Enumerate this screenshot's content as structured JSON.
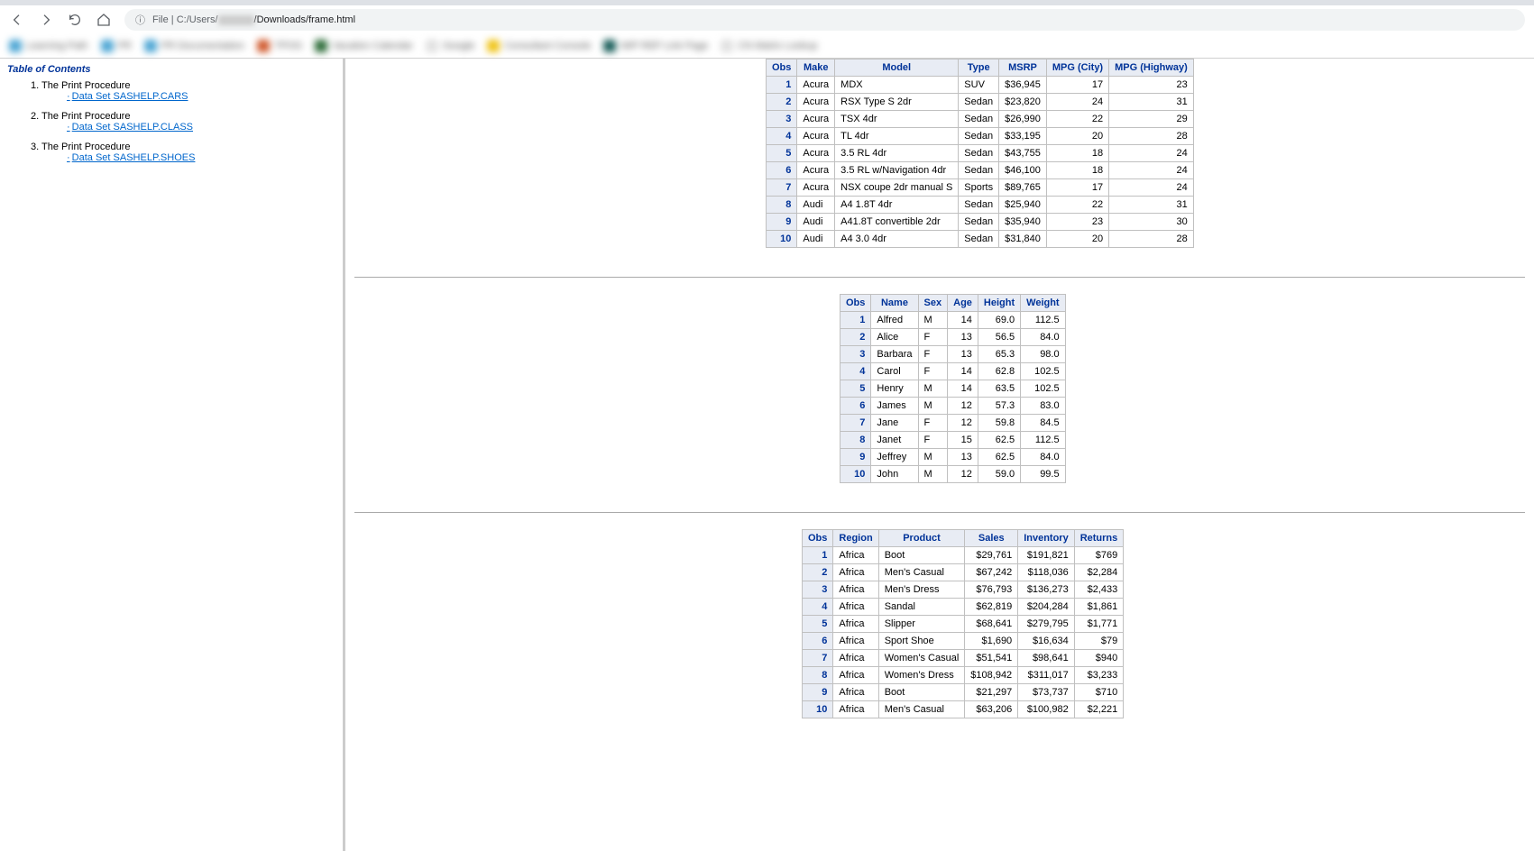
{
  "browser": {
    "url_prefix": "File  |  C:/Users/",
    "url_suffix": "/Downloads/frame.html",
    "info_icon": "ⓘ"
  },
  "bookmarks": [
    {
      "color": "#4da6d4",
      "text": "Learning Path"
    },
    {
      "color": "#4da6d4",
      "text": "PR"
    },
    {
      "color": "#4da6d4",
      "text": "PR Documentation"
    },
    {
      "color": "#d05a2e",
      "text": "TPOG"
    },
    {
      "color": "#2e6d3a",
      "text": "Vacation Calendar"
    },
    {
      "color": "#e0e0e0",
      "text": "Google"
    },
    {
      "color": "#f0c419",
      "text": "Consultant Console"
    },
    {
      "color": "#1a5e5a",
      "text": "MIP REP Link Page"
    },
    {
      "color": "#e0e0e0",
      "text": "CN Matrix Lookup"
    }
  ],
  "toc": {
    "title": "Table of Contents",
    "items": [
      {
        "num": "1.",
        "proc": "The Print Procedure",
        "link": "Data Set SASHELP.CARS"
      },
      {
        "num": "2.",
        "proc": "The Print Procedure",
        "link": "Data Set SASHELP.CLASS"
      },
      {
        "num": "3.",
        "proc": "The Print Procedure",
        "link": "Data Set SASHELP.SHOES"
      }
    ]
  },
  "tables": {
    "cars": {
      "headers": [
        "Obs",
        "Make",
        "Model",
        "Type",
        "MSRP",
        "MPG (City)",
        "MPG (Highway)"
      ],
      "rows": [
        [
          "1",
          "Acura",
          "MDX",
          "SUV",
          "$36,945",
          "17",
          "23"
        ],
        [
          "2",
          "Acura",
          "RSX Type S 2dr",
          "Sedan",
          "$23,820",
          "24",
          "31"
        ],
        [
          "3",
          "Acura",
          "TSX 4dr",
          "Sedan",
          "$26,990",
          "22",
          "29"
        ],
        [
          "4",
          "Acura",
          "TL 4dr",
          "Sedan",
          "$33,195",
          "20",
          "28"
        ],
        [
          "5",
          "Acura",
          "3.5 RL 4dr",
          "Sedan",
          "$43,755",
          "18",
          "24"
        ],
        [
          "6",
          "Acura",
          "3.5 RL w/Navigation 4dr",
          "Sedan",
          "$46,100",
          "18",
          "24"
        ],
        [
          "7",
          "Acura",
          "NSX coupe 2dr manual S",
          "Sports",
          "$89,765",
          "17",
          "24"
        ],
        [
          "8",
          "Audi",
          "A4 1.8T 4dr",
          "Sedan",
          "$25,940",
          "22",
          "31"
        ],
        [
          "9",
          "Audi",
          "A41.8T convertible 2dr",
          "Sedan",
          "$35,940",
          "23",
          "30"
        ],
        [
          "10",
          "Audi",
          "A4 3.0 4dr",
          "Sedan",
          "$31,840",
          "20",
          "28"
        ]
      ]
    },
    "class": {
      "headers": [
        "Obs",
        "Name",
        "Sex",
        "Age",
        "Height",
        "Weight"
      ],
      "rows": [
        [
          "1",
          "Alfred",
          "M",
          "14",
          "69.0",
          "112.5"
        ],
        [
          "2",
          "Alice",
          "F",
          "13",
          "56.5",
          "84.0"
        ],
        [
          "3",
          "Barbara",
          "F",
          "13",
          "65.3",
          "98.0"
        ],
        [
          "4",
          "Carol",
          "F",
          "14",
          "62.8",
          "102.5"
        ],
        [
          "5",
          "Henry",
          "M",
          "14",
          "63.5",
          "102.5"
        ],
        [
          "6",
          "James",
          "M",
          "12",
          "57.3",
          "83.0"
        ],
        [
          "7",
          "Jane",
          "F",
          "12",
          "59.8",
          "84.5"
        ],
        [
          "8",
          "Janet",
          "F",
          "15",
          "62.5",
          "112.5"
        ],
        [
          "9",
          "Jeffrey",
          "M",
          "13",
          "62.5",
          "84.0"
        ],
        [
          "10",
          "John",
          "M",
          "12",
          "59.0",
          "99.5"
        ]
      ]
    },
    "shoes": {
      "headers": [
        "Obs",
        "Region",
        "Product",
        "Sales",
        "Inventory",
        "Returns"
      ],
      "rows": [
        [
          "1",
          "Africa",
          "Boot",
          "$29,761",
          "$191,821",
          "$769"
        ],
        [
          "2",
          "Africa",
          "Men's Casual",
          "$67,242",
          "$118,036",
          "$2,284"
        ],
        [
          "3",
          "Africa",
          "Men's Dress",
          "$76,793",
          "$136,273",
          "$2,433"
        ],
        [
          "4",
          "Africa",
          "Sandal",
          "$62,819",
          "$204,284",
          "$1,861"
        ],
        [
          "5",
          "Africa",
          "Slipper",
          "$68,641",
          "$279,795",
          "$1,771"
        ],
        [
          "6",
          "Africa",
          "Sport Shoe",
          "$1,690",
          "$16,634",
          "$79"
        ],
        [
          "7",
          "Africa",
          "Women's Casual",
          "$51,541",
          "$98,641",
          "$940"
        ],
        [
          "8",
          "Africa",
          "Women's Dress",
          "$108,942",
          "$311,017",
          "$3,233"
        ],
        [
          "9",
          "Africa",
          "Boot",
          "$21,297",
          "$73,737",
          "$710"
        ],
        [
          "10",
          "Africa",
          "Men's Casual",
          "$63,206",
          "$100,982",
          "$2,221"
        ]
      ]
    }
  }
}
